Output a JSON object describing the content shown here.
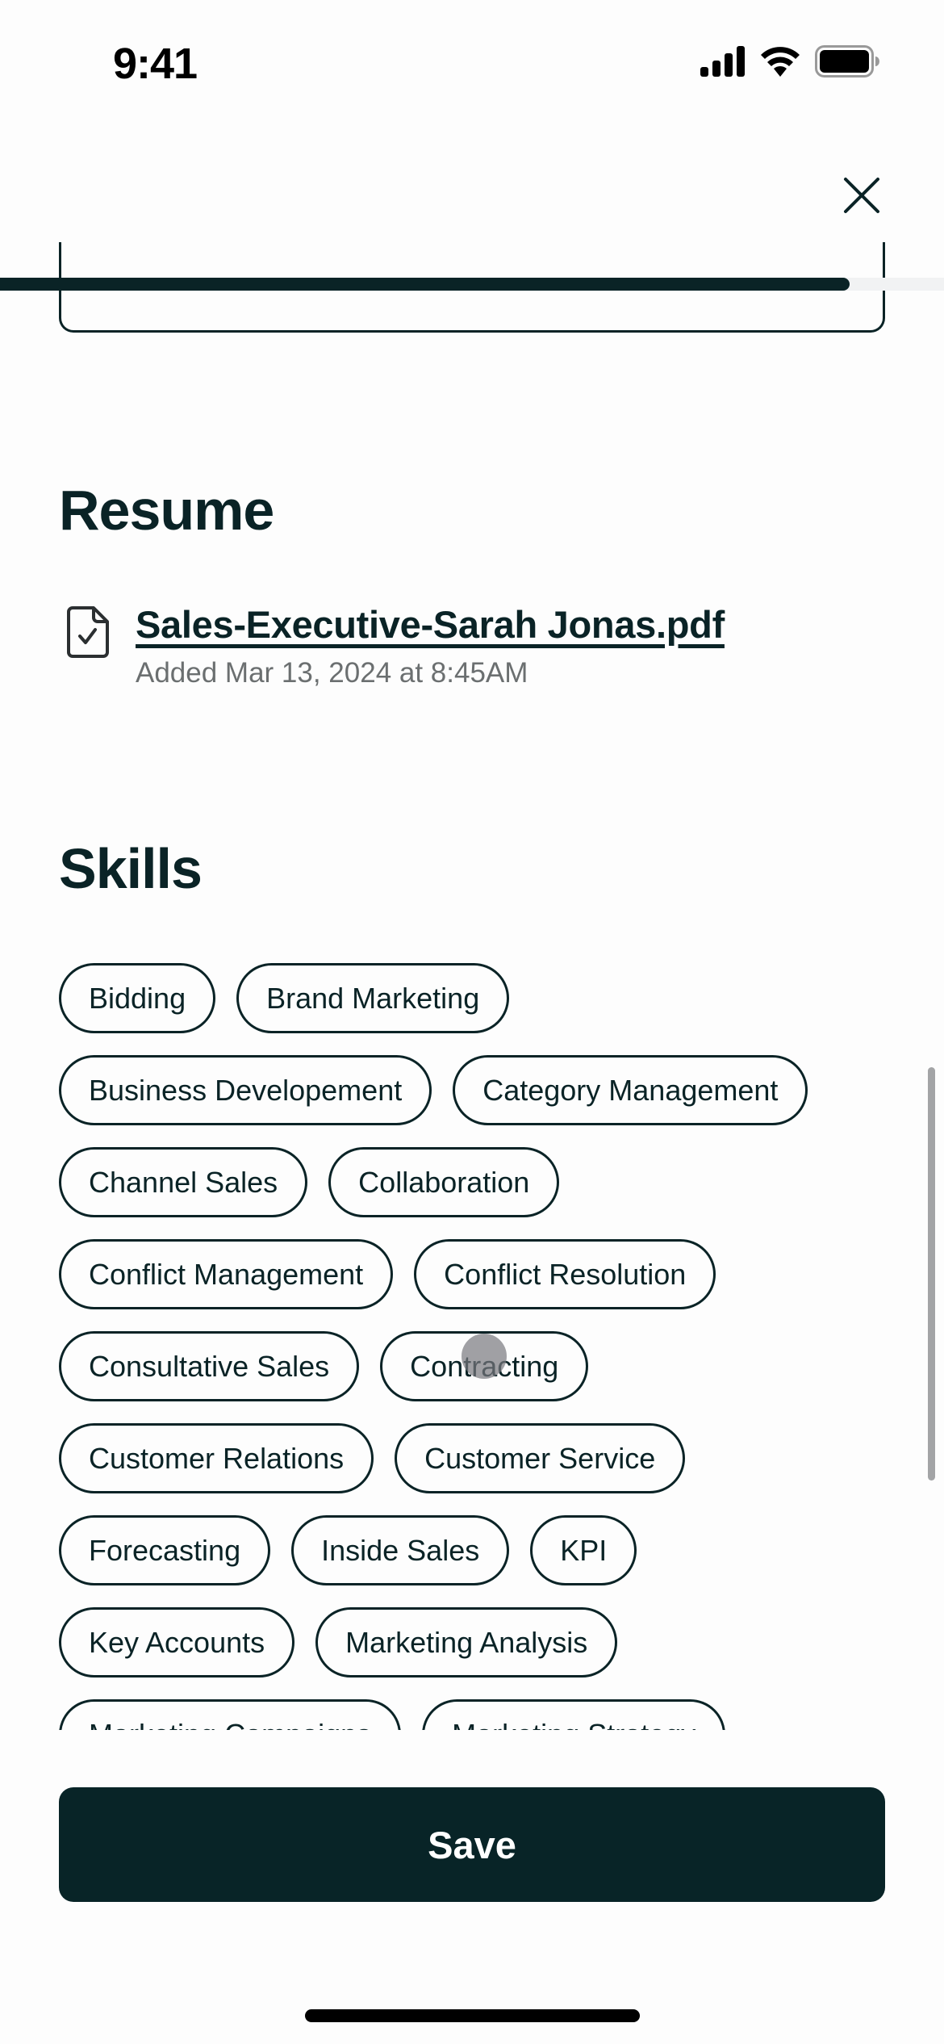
{
  "status_bar": {
    "time": "9:41",
    "icons": [
      "cellular-signal-icon",
      "wifi-icon",
      "battery-icon"
    ]
  },
  "header": {
    "close_icon": "close-icon",
    "progress_fraction": 0.9
  },
  "resume": {
    "title": "Resume",
    "file_icon": "document-check-icon",
    "file_name": "Sales-Executive-Sarah Jonas.pdf",
    "added_text": "Added Mar 13, 2024 at 8:45AM"
  },
  "skills": {
    "title": "Skills",
    "items": [
      "Bidding",
      "Brand Marketing",
      "Business Developement",
      "Category Management",
      "Channel Sales",
      "Collaboration",
      "Conflict Management",
      "Conflict Resolution",
      "Consultative Sales",
      "Contracting",
      "Customer Relations",
      "Customer Service",
      "Forecasting",
      "Inside Sales",
      "KPI",
      "Key Accounts",
      "Marketing Analysis",
      "Marketing Campaigns",
      "Marketing Strategy"
    ]
  },
  "footer": {
    "save_label": "Save"
  },
  "colors": {
    "primary": "#0a2326",
    "button": "#082427",
    "muted_text": "#6b6f70",
    "progress_track": "#f1f2f3"
  }
}
